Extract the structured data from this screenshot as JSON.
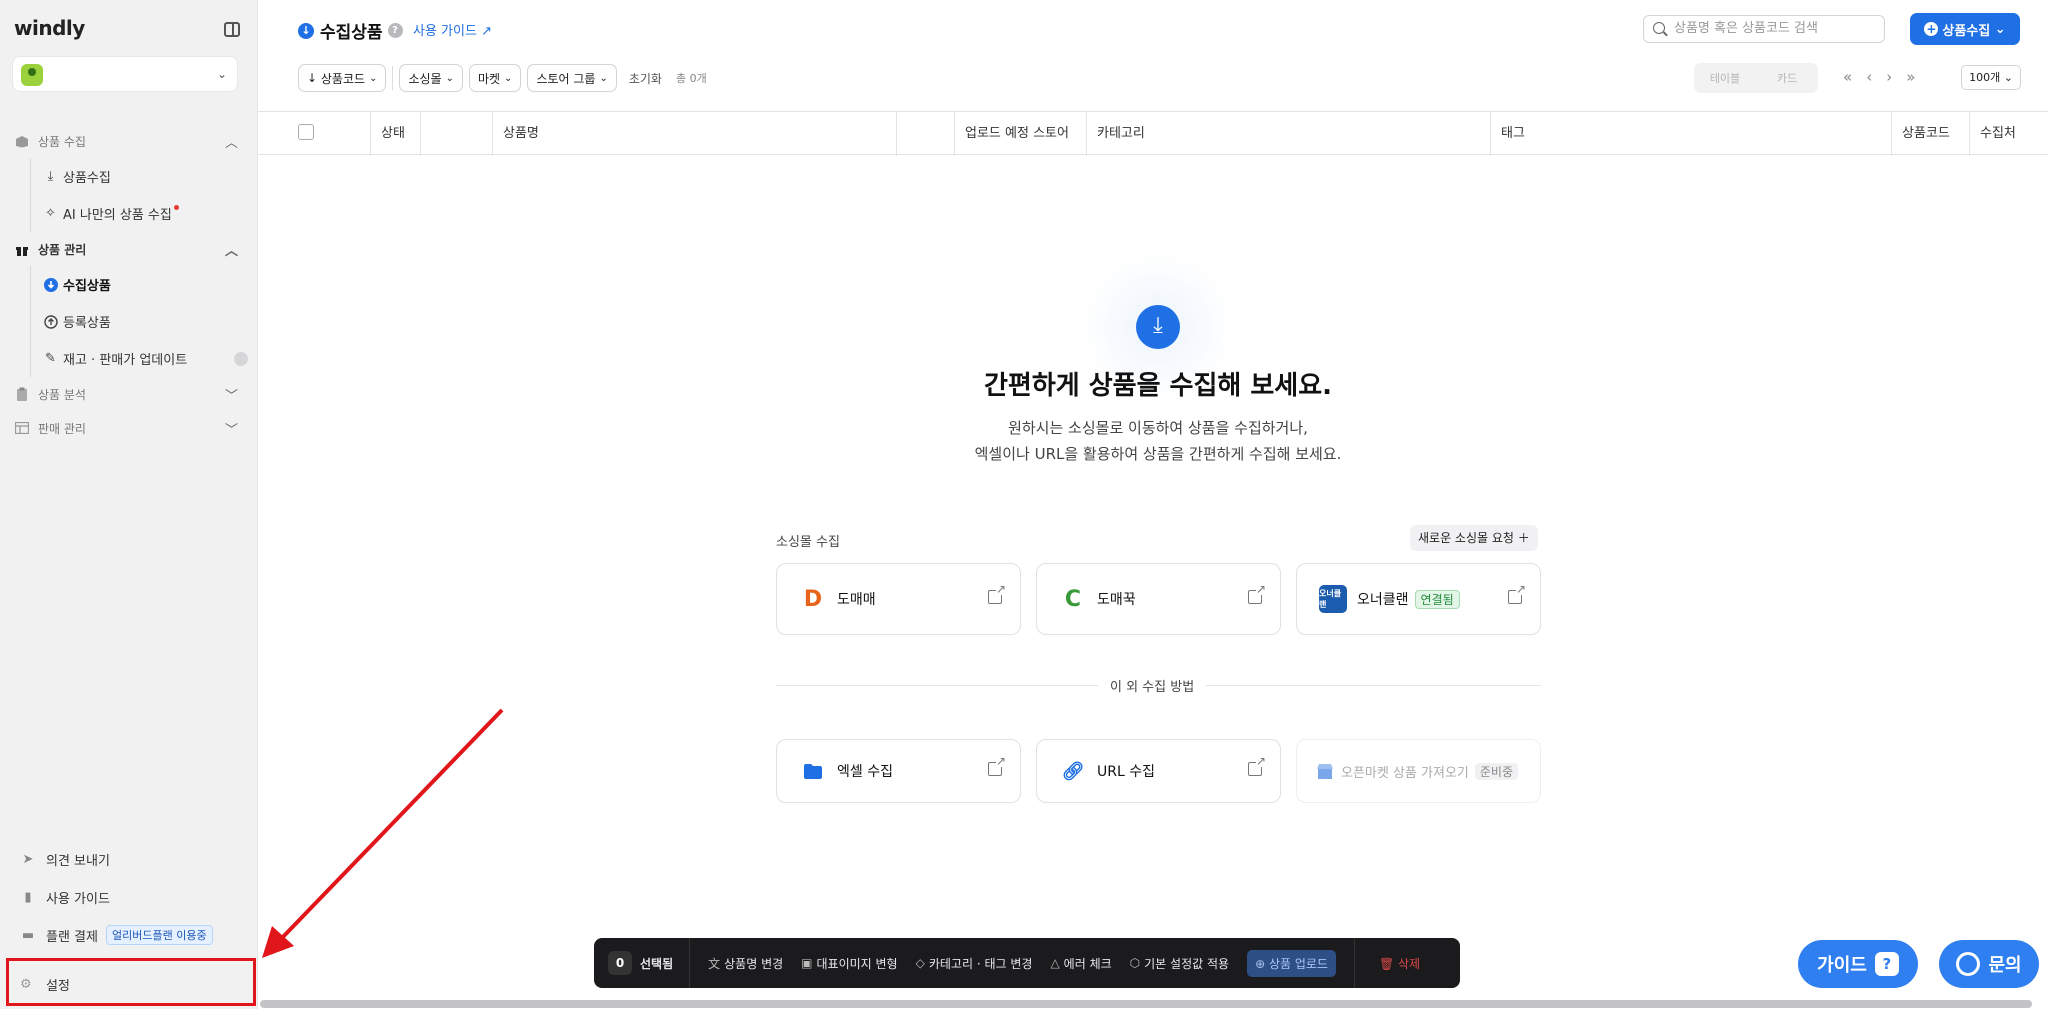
{
  "sidebar": {
    "logo": "windly",
    "sections": [
      {
        "label": "상품 수집",
        "items": [
          {
            "label": "상품수집"
          },
          {
            "label": "AI 나만의 상품 수집"
          }
        ]
      },
      {
        "label": "상품 관리",
        "items": [
          {
            "label": "수집상품"
          },
          {
            "label": "등록상품"
          },
          {
            "label": "재고 · 판매가 업데이트"
          }
        ]
      },
      {
        "label": "상품 분석"
      },
      {
        "label": "판매 관리"
      }
    ],
    "bottom": {
      "feedback": "의견 보내기",
      "guide": "사용 가이드",
      "plan": "플랜 결제",
      "plan_badge": "얼리버드플랜 이용중",
      "settings": "설정"
    }
  },
  "header": {
    "title": "수집상품",
    "guide_link": "사용 가이드",
    "search_placeholder": "상품명 혹은 상품코드 검색",
    "primary_button": "상품수집",
    "filters": [
      "상품코드",
      "소싱몰",
      "마켓",
      "스토어 그룹"
    ],
    "reset": "초기화",
    "total": "총 0개",
    "view_table": "테이블",
    "view_card": "카드",
    "per_page": "100개"
  },
  "table": {
    "columns": [
      "상태",
      "상품명",
      "업로드 예정 스토어",
      "카테고리",
      "태그",
      "상품코드",
      "수집처"
    ]
  },
  "empty": {
    "title": "간편하게 상품을 수집해 보세요.",
    "subtitle_1": "원하시는 소싱몰로 이동하여 상품을 수집하거나,",
    "subtitle_2": "엑셀이나 URL을 활용하여 상품을 간편하게 수집해 보세요.",
    "source_label": "소싱몰 수집",
    "request_button": "새로운 소싱몰 요청",
    "sources": [
      {
        "name": "도매매"
      },
      {
        "name": "도매꾹"
      },
      {
        "name": "오너클랜",
        "badge": "연결됨",
        "logo_text": "오너클랜"
      }
    ],
    "other_label": "이 외 수집 방법",
    "others": [
      {
        "name": "엑셀 수집"
      },
      {
        "name": "URL 수집"
      },
      {
        "name": "오픈마켓 상품 가져오기",
        "badge": "준비중"
      }
    ]
  },
  "toolbar": {
    "count": "0",
    "selected": "선택됨",
    "actions": [
      "상품명 변경",
      "대표이미지 변형",
      "카테고리 · 태그 변경",
      "에러 체크",
      "기본 설정값 적용"
    ],
    "upload": "상품 업로드",
    "delete": "삭제"
  },
  "floating": {
    "guide": "가이드",
    "ask": "문의"
  },
  "colors": {
    "accent": "#1f6fe5",
    "highlight": "#e0161b"
  }
}
